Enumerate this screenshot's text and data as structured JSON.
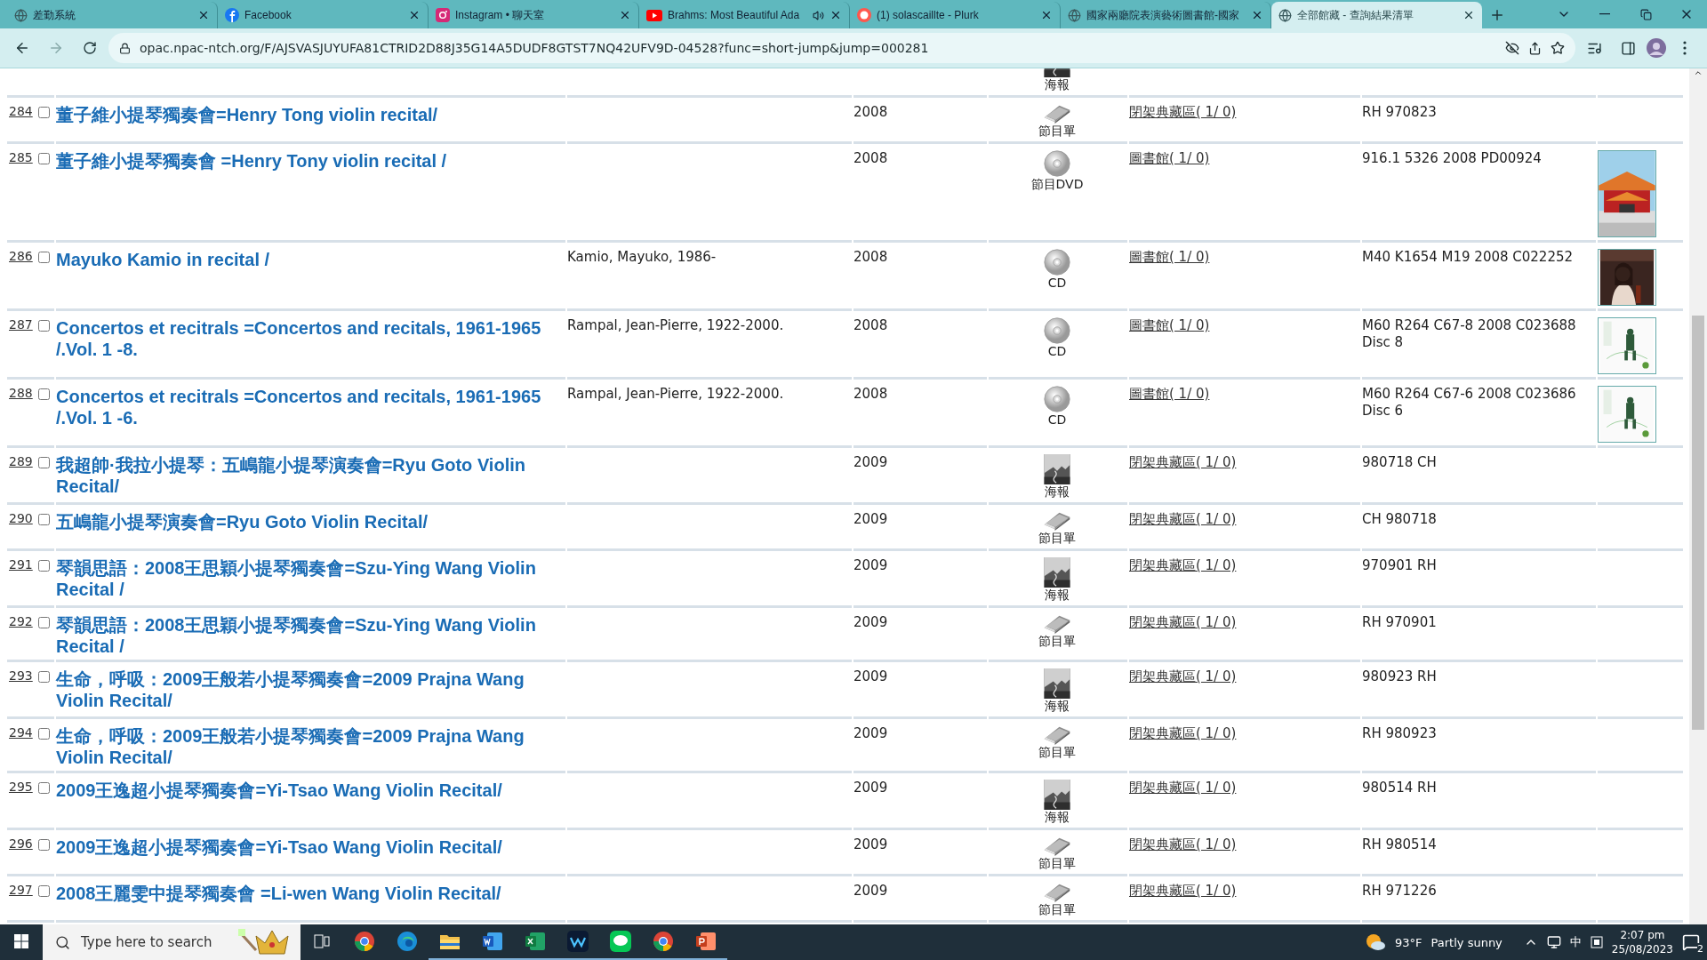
{
  "browser": {
    "tabs": [
      {
        "title": "差勤系統",
        "selected": false
      },
      {
        "title": "Facebook",
        "selected": false
      },
      {
        "title": "Instagram • 聊天室",
        "selected": false
      },
      {
        "title": "Brahms: Most Beautiful Ada",
        "selected": false,
        "audio": true
      },
      {
        "title": "(1) solascaillte - Plurk",
        "selected": false
      },
      {
        "title": "國家兩廳院表演藝術圖書館-國家",
        "selected": false
      },
      {
        "title": "全部館藏 - 查詢結果清單",
        "selected": true
      }
    ],
    "url": "opac.npac-ntch.org/F/AJSVASJUYUFA81CTRID2D88J35G14A5DUDF8GTST7NQ42UFV9D-04528?func=short-jump&jump=000281"
  },
  "top_partial": {
    "format": {
      "kind": "poster",
      "label": "海報"
    }
  },
  "rows": [
    {
      "number": "284",
      "checked": false,
      "title": "董子維小提琴獨奏會=Henry Tong violin recital/",
      "year": "2008",
      "format": {
        "kind": "program",
        "label": "節目單"
      },
      "location": "閉架典藏區( 1/ 0)",
      "call_number": "RH 970823",
      "cover": false
    },
    {
      "number": "285",
      "checked": false,
      "title": "董子維小提琴獨奏會 =Henry Tony violin recital /",
      "year": "2008",
      "format": {
        "kind": "dvd",
        "label": "節目DVD"
      },
      "location": "圖書館( 1/ 0)",
      "call_number": "916.1 5326 2008 PD00924",
      "cover": true
    },
    {
      "number": "286",
      "checked": false,
      "title": "Mayuko Kamio in recital /",
      "author": "Kamio, Mayuko, 1986-",
      "year": "2008",
      "format": {
        "kind": "cd",
        "label": "CD"
      },
      "location": "圖書館( 1/ 0)",
      "call_number": "M40 K1654 M19 2008 C022252",
      "cover": true
    },
    {
      "number": "287",
      "checked": false,
      "title": "Concertos et recitrals =Concertos and recitals, 1961-1965 /.Vol. 1 -8.",
      "author": "Rampal, Jean-Pierre, 1922-2000.",
      "year": "2008",
      "format": {
        "kind": "cd",
        "label": "CD"
      },
      "location": "圖書館( 1/ 0)",
      "call_number": "M60 R264 C67-8 2008 C023688 Disc 8",
      "cover": true
    },
    {
      "number": "288",
      "checked": false,
      "title": "Concertos et recitrals =Concertos and recitals, 1961-1965 /.Vol. 1 -6.",
      "author": "Rampal, Jean-Pierre, 1922-2000.",
      "year": "2008",
      "format": {
        "kind": "cd",
        "label": "CD"
      },
      "location": "圖書館( 1/ 0)",
      "call_number": "M60 R264 C67-6 2008 C023686 Disc 6",
      "cover": true
    },
    {
      "number": "289",
      "checked": false,
      "title": "我超帥·我拉小提琴：五嶋龍小提琴演奏會=Ryu Goto Violin Recital/",
      "year": "2009",
      "format": {
        "kind": "poster",
        "label": "海報"
      },
      "location": "閉架典藏區( 1/ 0)",
      "call_number": "980718 CH",
      "cover": false
    },
    {
      "number": "290",
      "checked": false,
      "title": "五嶋龍小提琴演奏會=Ryu Goto Violin Recital/",
      "year": "2009",
      "format": {
        "kind": "program",
        "label": "節目單"
      },
      "location": "閉架典藏區( 1/ 0)",
      "call_number": "CH 980718",
      "cover": false
    },
    {
      "number": "291",
      "checked": false,
      "title": "琴韻思語：2008王思穎小提琴獨奏會=Szu-Ying Wang Violin Recital /",
      "year": "2009",
      "format": {
        "kind": "poster",
        "label": "海報"
      },
      "location": "閉架典藏區( 1/ 0)",
      "call_number": "970901 RH",
      "cover": false
    },
    {
      "number": "292",
      "checked": false,
      "title": "琴韻思語：2008王思穎小提琴獨奏會=Szu-Ying Wang Violin Recital /",
      "year": "2009",
      "format": {
        "kind": "program",
        "label": "節目單"
      },
      "location": "閉架典藏區( 1/ 0)",
      "call_number": "RH 970901",
      "cover": false
    },
    {
      "number": "293",
      "checked": false,
      "title": "生命，呼吸：2009王般若小提琴獨奏會=2009 Prajna Wang Violin Recital/",
      "year": "2009",
      "format": {
        "kind": "poster",
        "label": "海報"
      },
      "location": "閉架典藏區( 1/ 0)",
      "call_number": "980923 RH",
      "cover": false
    },
    {
      "number": "294",
      "checked": false,
      "title": "生命，呼吸：2009王般若小提琴獨奏會=2009 Prajna Wang Violin Recital/",
      "year": "2009",
      "format": {
        "kind": "program",
        "label": "節目單"
      },
      "location": "閉架典藏區( 1/ 0)",
      "call_number": "RH 980923",
      "cover": false
    },
    {
      "number": "295",
      "checked": false,
      "title": "2009王逸超小提琴獨奏會=Yi-Tsao Wang Violin Recital/",
      "year": "2009",
      "format": {
        "kind": "poster",
        "label": "海報"
      },
      "location": "閉架典藏區( 1/ 0)",
      "call_number": "980514 RH",
      "cover": false
    },
    {
      "number": "296",
      "checked": false,
      "title": "2009王逸超小提琴獨奏會=Yi-Tsao Wang Violin Recital/",
      "year": "2009",
      "format": {
        "kind": "program",
        "label": "節目單"
      },
      "location": "閉架典藏區( 1/ 0)",
      "call_number": "RH 980514",
      "cover": false
    },
    {
      "number": "297",
      "checked": false,
      "title": "2008王麗雯中提琴獨奏會 =Li-wen Wang Violin Recital/",
      "year": "2009",
      "format": {
        "kind": "program",
        "label": "節目單"
      },
      "location": "閉架典藏區( 1/ 0)",
      "call_number": "RH 971226",
      "cover": false
    }
  ],
  "taskbar": {
    "search_placeholder": "Type here to search",
    "apps": [
      {
        "kind": "taskview",
        "active": false
      },
      {
        "kind": "chrome",
        "active": false
      },
      {
        "kind": "edge",
        "active": false
      },
      {
        "kind": "explorer",
        "active": true
      },
      {
        "kind": "word",
        "active": true
      },
      {
        "kind": "excel",
        "active": true
      },
      {
        "kind": "wapp",
        "active": true
      },
      {
        "kind": "line",
        "active": true
      },
      {
        "kind": "chrome2",
        "active": true
      },
      {
        "kind": "powerpoint",
        "active": true
      }
    ],
    "weather": "93°F",
    "weather_text": "Partly sunny",
    "ime": "中",
    "time": "2:07 pm",
    "date": "25/08/2023",
    "notifications": "2"
  }
}
